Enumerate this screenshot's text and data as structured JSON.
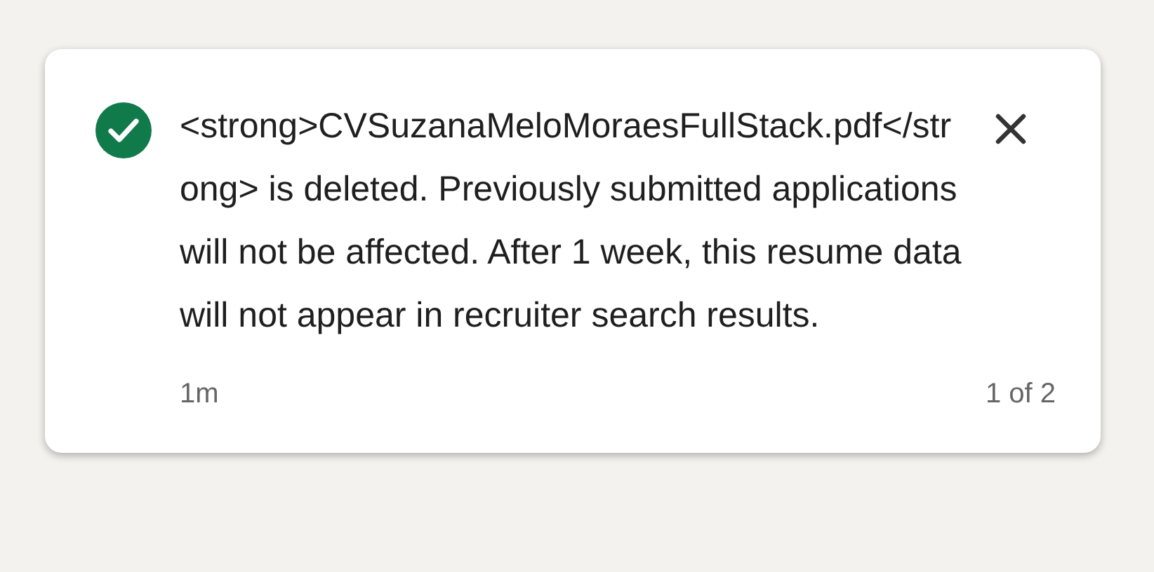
{
  "toast": {
    "message": "<strong>CVSuzanaMeloMoraesFullStack.pdf</strong> is deleted. Previously submitted applications will not be affected. After 1 week, this resume data will not appear in recruiter search results.",
    "time": "1m",
    "counter": "1 of 2"
  }
}
